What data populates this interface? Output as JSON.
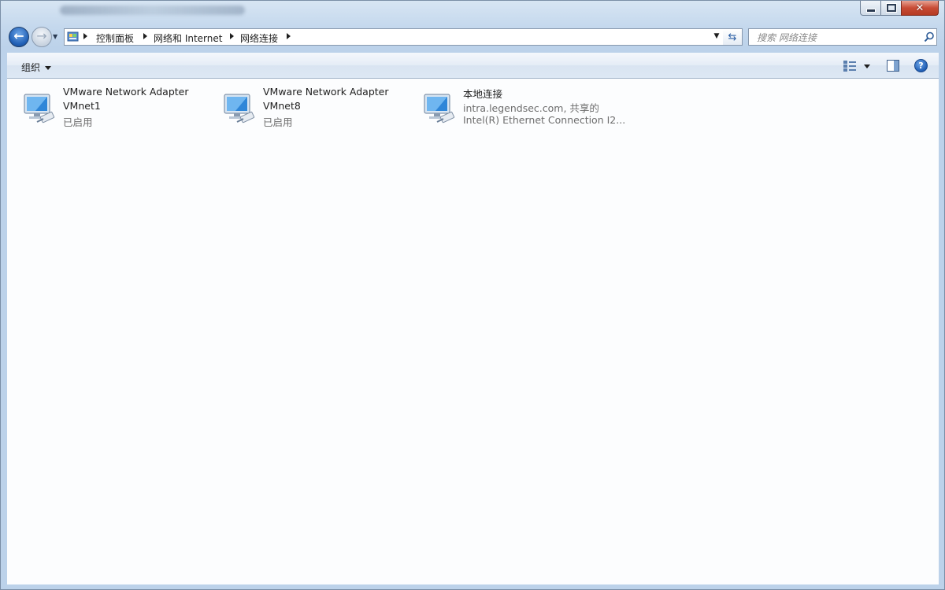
{
  "window": {
    "title_blurred": true,
    "controls": {
      "minimize": "minimize",
      "maximize": "maximize",
      "close": "close"
    }
  },
  "nav": {
    "breadcrumb": [
      "控制面板",
      "网络和 Internet",
      "网络连接"
    ],
    "search_placeholder": "搜索 网络连接"
  },
  "toolbar": {
    "organize_label": "组织"
  },
  "connections": [
    {
      "line1": "VMware Network Adapter",
      "line2": "VMnet1",
      "line3": "已启用"
    },
    {
      "line1": "VMware Network Adapter",
      "line2": "VMnet8",
      "line3": "已启用"
    },
    {
      "line1": "本地连接",
      "line2": "intra.legendsec.com, 共享的",
      "line3": "Intel(R) Ethernet Connection I2..."
    }
  ],
  "colors": {
    "accent": "#2160b6",
    "close_button": "#c84c36",
    "muted_text": "#6d6d6d"
  }
}
